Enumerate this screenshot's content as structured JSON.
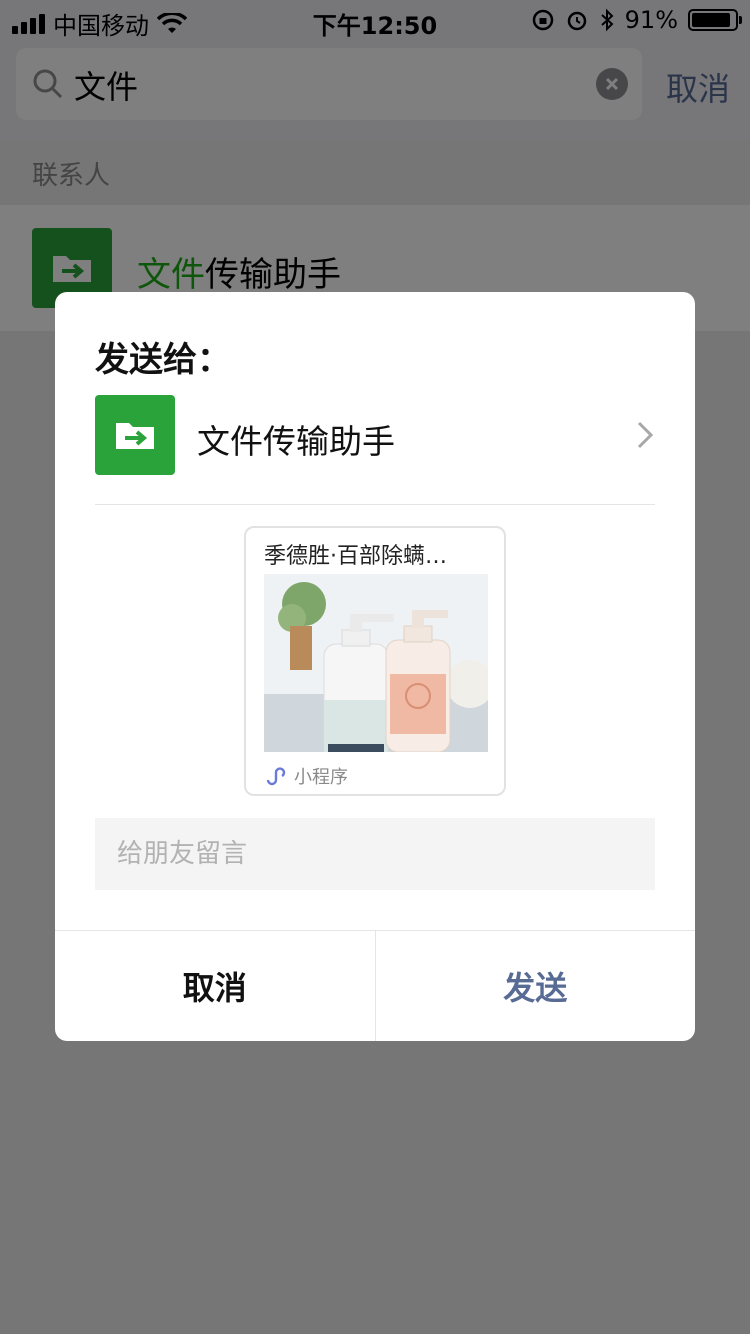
{
  "status_bar": {
    "carrier": "中国移动",
    "time": "下午12:50",
    "battery": "91%",
    "battery_level": 0.91
  },
  "search": {
    "query": "文件",
    "cancel_label": "取消"
  },
  "results": {
    "section_label": "联系人",
    "contact": {
      "highlight": "文件",
      "rest": "传输助手"
    }
  },
  "dialog": {
    "title": "发送给：",
    "recipient_name": "文件传输助手",
    "card": {
      "title": "季德胜·百部除螨…",
      "footer": "小程序"
    },
    "message_placeholder": "给朋友留言",
    "cancel_label": "取消",
    "send_label": "发送"
  },
  "colors": {
    "accent": "#1aad19",
    "link": "#576b95",
    "file_helper_green": "#2aa33b"
  }
}
